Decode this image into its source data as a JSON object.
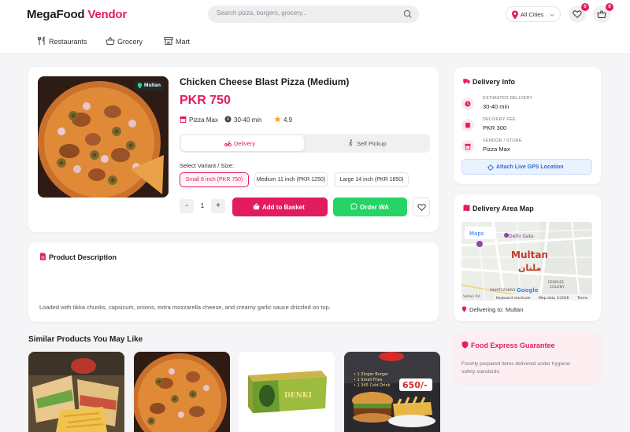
{
  "header": {
    "brand": "MegaFood",
    "brand_accent": "Vendor",
    "search_placeholder": "Search pizza, burgers, grocery...",
    "city": "All Cities",
    "wishlist_count": "0",
    "cart_count": "0"
  },
  "nav": [
    {
      "label": "Restaurants",
      "icon": "cutlery-icon"
    },
    {
      "label": "Grocery",
      "icon": "basket-icon"
    },
    {
      "label": "Mart",
      "icon": "store-icon"
    }
  ],
  "product": {
    "city_tag": "Multan",
    "title": "Chicken Cheese Blast Pizza (Medium)",
    "price": "PKR 750",
    "vendor": "Pizza Max",
    "time": "30-40 min",
    "rating": "4.9",
    "delivery_tab": "Delivery",
    "pickup_tab": "Self Pickup",
    "variant_label": "Select Variant / Size:",
    "variants": [
      "Small 8 inch (PKR 750)",
      "Medium 11 inch (PKR 1250)",
      "Large 14 inch (PKR 1850)"
    ],
    "quantity": "1",
    "minus": "-",
    "plus": "+",
    "add_to_basket": "Add to Basket",
    "order_wa": "Order WA"
  },
  "description": {
    "title": "Product Description",
    "text": "Loaded with tikka chunks, capsicum, onions, extra mozzarella cheese, and creamy garlic sauce drizzled on top."
  },
  "delivery_info": {
    "title": "Delivery Info",
    "rows": [
      {
        "key": "ESTIMATED DELIVERY",
        "value": "30-40 min"
      },
      {
        "key": "DELIVERY FEE",
        "value": "PKR 300"
      },
      {
        "key": "VENDOR / STORE",
        "value": "Pizza Max"
      }
    ],
    "gps_button": "Attach Live GPS Location"
  },
  "map_card": {
    "title": "Delivery Area Map",
    "maps_label": "Maps",
    "place_en": "Multan",
    "place_ur": "ملتان",
    "poi": "Delhi Gate",
    "area1": "PEOPLES",
    "area2": "COLONY",
    "area3": "MUMTAZABAD",
    "road": "Vehari Rd",
    "google": "Google",
    "shortcuts": "Keyboard shortcuts",
    "mapdata": "Map data ©2026",
    "terms": "Terms",
    "delivering_to": "Delivering to: Multan"
  },
  "guarantee": {
    "title": "Food Express Guarantee",
    "text": "Freshly prepared items delivered under hygiene safety standards."
  },
  "similar": {
    "title": "Similar Products You May Like",
    "promo_lines": [
      "• 1 Zinger Burger",
      "• 1 Small Fries",
      "• 1 345 Cold Drink"
    ],
    "promo_price": "650/-",
    "box_brand": "DENKI"
  },
  "colors": {
    "accent": "#e31c5f",
    "whatsapp": "#25d366",
    "gps_blue": "#2f6fdb",
    "guarantee_bg": "#fdeef2"
  }
}
